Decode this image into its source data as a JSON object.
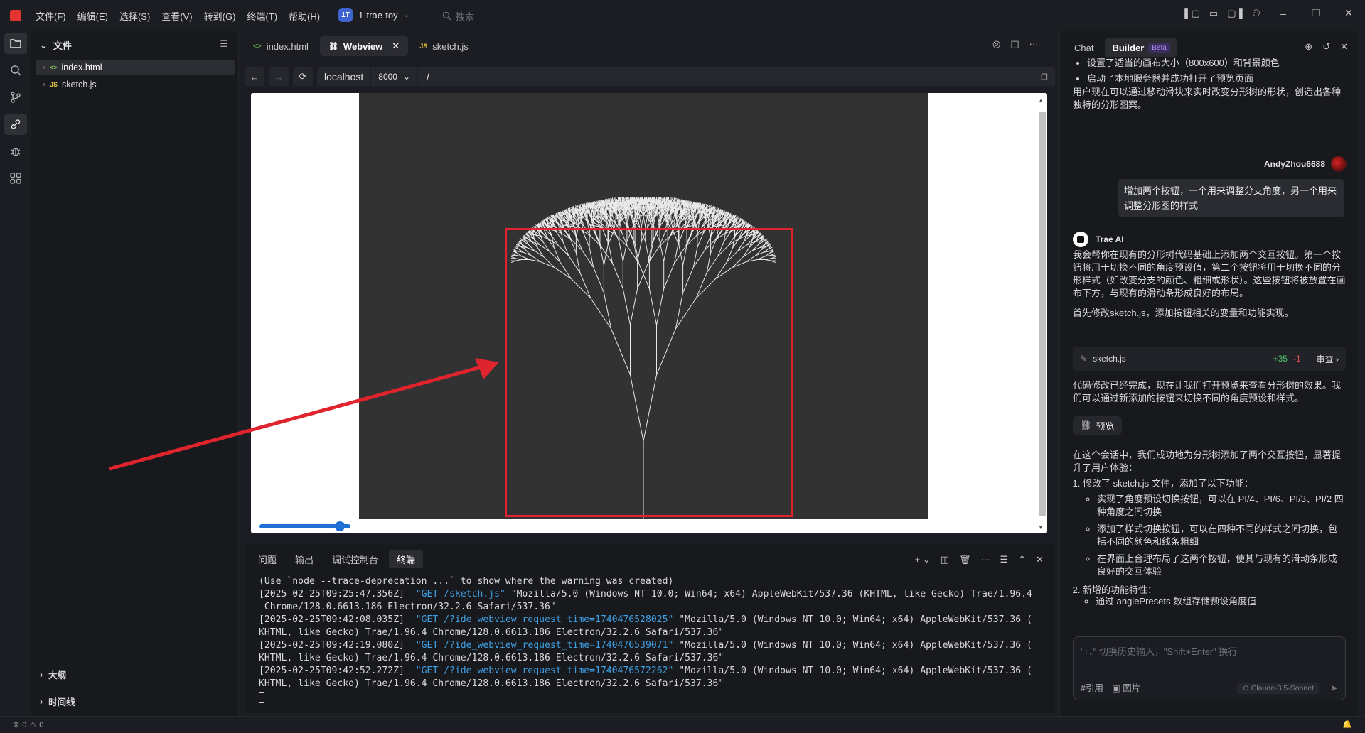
{
  "titlebar": {
    "menus": [
      "文件(F)",
      "编辑(E)",
      "选择(S)",
      "查看(V)",
      "转到(G)",
      "终端(T)",
      "帮助(H)"
    ],
    "project_badge": "1T",
    "project_name": "1-trae-toy",
    "search_placeholder": "搜索"
  },
  "explorer": {
    "header": "文件",
    "files": [
      {
        "icon": "html-icon",
        "ext_label": "<>",
        "name": "index.html",
        "selected": true
      },
      {
        "icon": "js-icon",
        "ext_label": "JS",
        "name": "sketch.js",
        "selected": false
      }
    ],
    "outline_label": "大纲",
    "timeline_label": "时间线"
  },
  "editor": {
    "tabs": [
      {
        "ext_label": "<>",
        "label": "index.html",
        "active": false
      },
      {
        "ext_label": "⛓",
        "label": "Webview",
        "active": true
      },
      {
        "ext_label": "JS",
        "label": "sketch.js",
        "active": false
      }
    ],
    "nav": {
      "host": "localhost",
      "port": "8000",
      "path": "/"
    }
  },
  "webview": {
    "slider_value_fraction": 0.88
  },
  "panel": {
    "tabs": [
      "问题",
      "输出",
      "调试控制台",
      "终端"
    ],
    "active_tab": "终端",
    "terminal_lines": [
      {
        "text": "(Use `node --trace-deprecation ...` to show where the warning was created)"
      },
      {
        "pre": "[2025-02-25T09:25:47.356Z]  ",
        "req": "\"GET /sketch.js\"",
        "post": " \"Mozilla/5.0 (Windows NT 10.0; Win64; x64) AppleWebKit/537.36 (KHTML, like Gecko) Trae/1.96.4"
      },
      {
        "text": " Chrome/128.0.6613.186 Electron/32.2.6 Safari/537.36\""
      },
      {
        "pre": "[2025-02-25T09:42:08.035Z]  ",
        "req": "\"GET /?ide_webview_request_time=1740476528025\"",
        "post": " \"Mozilla/5.0 (Windows NT 10.0; Win64; x64) AppleWebKit/537.36 ("
      },
      {
        "text": "KHTML, like Gecko) Trae/1.96.4 Chrome/128.0.6613.186 Electron/32.2.6 Safari/537.36\""
      },
      {
        "pre": "[2025-02-25T09:42:19.080Z]  ",
        "req": "\"GET /?ide_webview_request_time=1740476539071\"",
        "post": " \"Mozilla/5.0 (Windows NT 10.0; Win64; x64) AppleWebKit/537.36 ("
      },
      {
        "text": "KHTML, like Gecko) Trae/1.96.4 Chrome/128.0.6613.186 Electron/32.2.6 Safari/537.36\""
      },
      {
        "pre": "[2025-02-25T09:42:52.272Z]  ",
        "req": "\"GET /?ide_webview_request_time=1740476572262\"",
        "post": " \"Mozilla/5.0 (Windows NT 10.0; Win64; x64) AppleWebKit/537.36 ("
      },
      {
        "text": "KHTML, like Gecko) Trae/1.96.4 Chrome/128.0.6613.186 Electron/32.2.6 Safari/537.36\""
      }
    ]
  },
  "chat": {
    "tab_chat": "Chat",
    "tab_builder": "Builder",
    "beta": "Beta",
    "intro_bullets": [
      "设置了适当的画布大小（800x600）和背景颜色",
      "启动了本地服务器并成功打开了预览页面"
    ],
    "intro_para": "用户现在可以通过移动滑块来实时改变分形树的形状，创造出各种独特的分形图案。",
    "user_name": "AndyZhou6688",
    "user_message": "增加两个按钮，一个用来调整分支角度，另一个用来调整分形图的样式",
    "ai_name": "Trae AI",
    "ai_para1": "我会帮你在现有的分形树代码基础上添加两个交互按钮。第一个按钮将用于切换不同的角度预设值，第二个按钮将用于切换不同的分形样式（如改变分支的颜色、粗细或形状）。这些按钮将被放置在画布下方，与现有的滑动条形成良好的布局。",
    "ai_para2": "首先修改sketch.js，添加按钮相关的变量和功能实现。",
    "file_card": {
      "name": "sketch.js",
      "added": "+35",
      "removed": "-1",
      "review": "审查"
    },
    "ai_para3": "代码修改已经完成，现在让我们打开预览来查看分形树的效果。我们可以通过新添加的按钮来切换不同的角度预设和样式。",
    "preview_label": "预览",
    "summary_para": "在这个会话中，我们成功地为分形树添加了两个交互按钮，显著提升了用户体验：",
    "summary_item1": "修改了 sketch.js 文件，添加了以下功能：",
    "summary_sub": [
      "实现了角度预设切换按钮，可以在 PI/4、PI/6、PI/3、PI/2 四种角度之间切换",
      "添加了样式切换按钮，可以在四种不同的样式之间切换，包括不同的颜色和线条粗细",
      "在界面上合理布局了这两个按钮，使其与现有的滑动条形成良好的交互体验"
    ],
    "summary_item2": "新增的功能特性：",
    "summary_item2_sub": "通过 anglePresets 数组存储预设角度值",
    "input_placeholder": "\"↑↓\" 切换历史输入，\"Shift+Enter\" 换行",
    "quote_label": "#引用",
    "image_label": "图片",
    "model": "Claude-3.5-Sonnet"
  },
  "status": {
    "errors": "0",
    "warnings": "0"
  },
  "annotation": {
    "box_color": "#e0242d"
  }
}
